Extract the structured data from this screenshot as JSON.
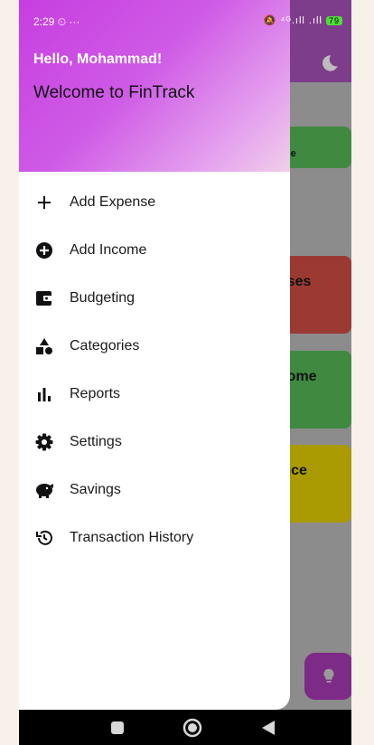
{
  "status_bar": {
    "time": "2:29",
    "extra": "⏲ ···",
    "signal": "🔕 ⁴ᴳ.ıll .ıll",
    "battery": "79"
  },
  "drawer": {
    "greeting": "Hello, Mohammad!",
    "welcome": "Welcome to FinTrack",
    "items": [
      {
        "label": "Add Expense",
        "icon": "plus-icon"
      },
      {
        "label": "Add Income",
        "icon": "add-circle-icon"
      },
      {
        "label": "Budgeting",
        "icon": "wallet-icon"
      },
      {
        "label": "Categories",
        "icon": "categories-icon"
      },
      {
        "label": "Reports",
        "icon": "bar-chart-icon"
      },
      {
        "label": "Settings",
        "icon": "gear-icon"
      },
      {
        "label": "Savings",
        "icon": "piggy-bank-icon"
      },
      {
        "label": "Transaction History",
        "icon": "history-icon"
      }
    ]
  },
  "background": {
    "card1_text": ")",
    "card1_sub": "come",
    "card2_text": "enses",
    "card3_text": "ncome",
    "card3_sub": ")",
    "card4_text": "lance"
  },
  "colors": {
    "drawer_gradient_start": "#c63ee0",
    "drawer_gradient_end": "#f0cfe9",
    "app_bar": "#7e3d8a",
    "income_card": "#3f8a40",
    "expense_card": "#9a3a33",
    "balance_card": "#a89a00",
    "fab": "#7d2b86"
  }
}
